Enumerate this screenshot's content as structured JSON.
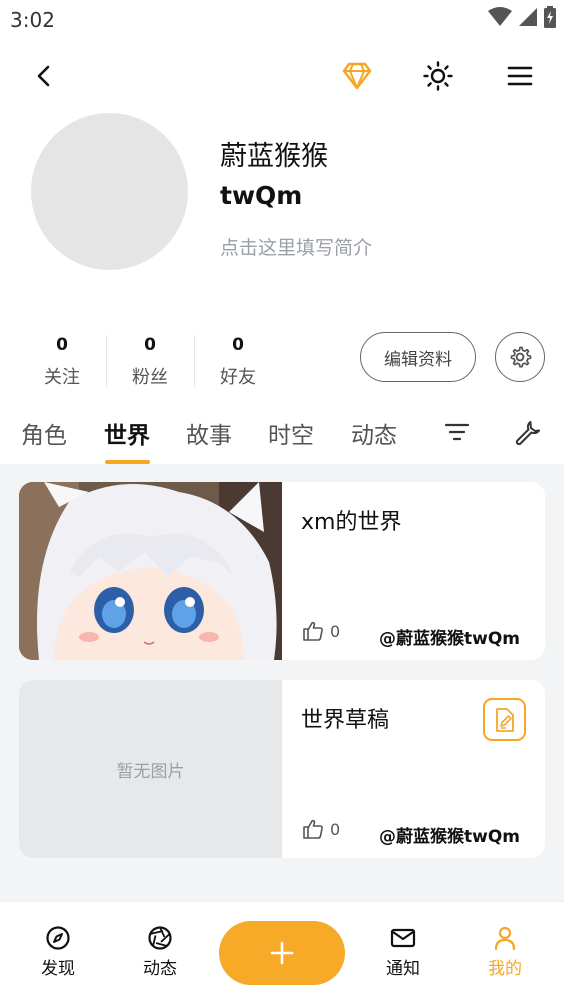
{
  "status_bar": {
    "time": "3:02"
  },
  "top_bar": {
    "icons": [
      "back-arrow-icon",
      "diamond-icon",
      "brightness-icon",
      "menu-icon"
    ]
  },
  "profile": {
    "display_name": "蔚蓝猴猴",
    "username": "twQm",
    "bio_placeholder": "点击这里填写简介"
  },
  "stats": [
    {
      "count": "0",
      "label": "关注"
    },
    {
      "count": "0",
      "label": "粉丝"
    },
    {
      "count": "0",
      "label": "好友"
    }
  ],
  "edit_profile_label": "编辑资料",
  "tabs": [
    {
      "label": "角色"
    },
    {
      "label": "世界",
      "active": true
    },
    {
      "label": "故事"
    },
    {
      "label": "时空"
    },
    {
      "label": "动态"
    }
  ],
  "cards": [
    {
      "title": "xm的世界",
      "likes": "0",
      "author": "@蔚蓝猴猴twQm",
      "has_image": true
    },
    {
      "title": "世界草稿",
      "likes": "0",
      "author": "@蔚蓝猴猴twQm",
      "no_image_text": "暂无图片",
      "draft": true
    }
  ],
  "bottom_nav": [
    {
      "label": "发现",
      "icon": "compass-icon"
    },
    {
      "label": "动态",
      "icon": "aperture-icon"
    },
    {
      "label": "通知",
      "icon": "mail-icon"
    },
    {
      "label": "我的",
      "icon": "person-icon",
      "active": true
    }
  ],
  "colors": {
    "accent": "#f5a623",
    "fab": "#f7a928",
    "content_bg": "#f3f4f6"
  }
}
